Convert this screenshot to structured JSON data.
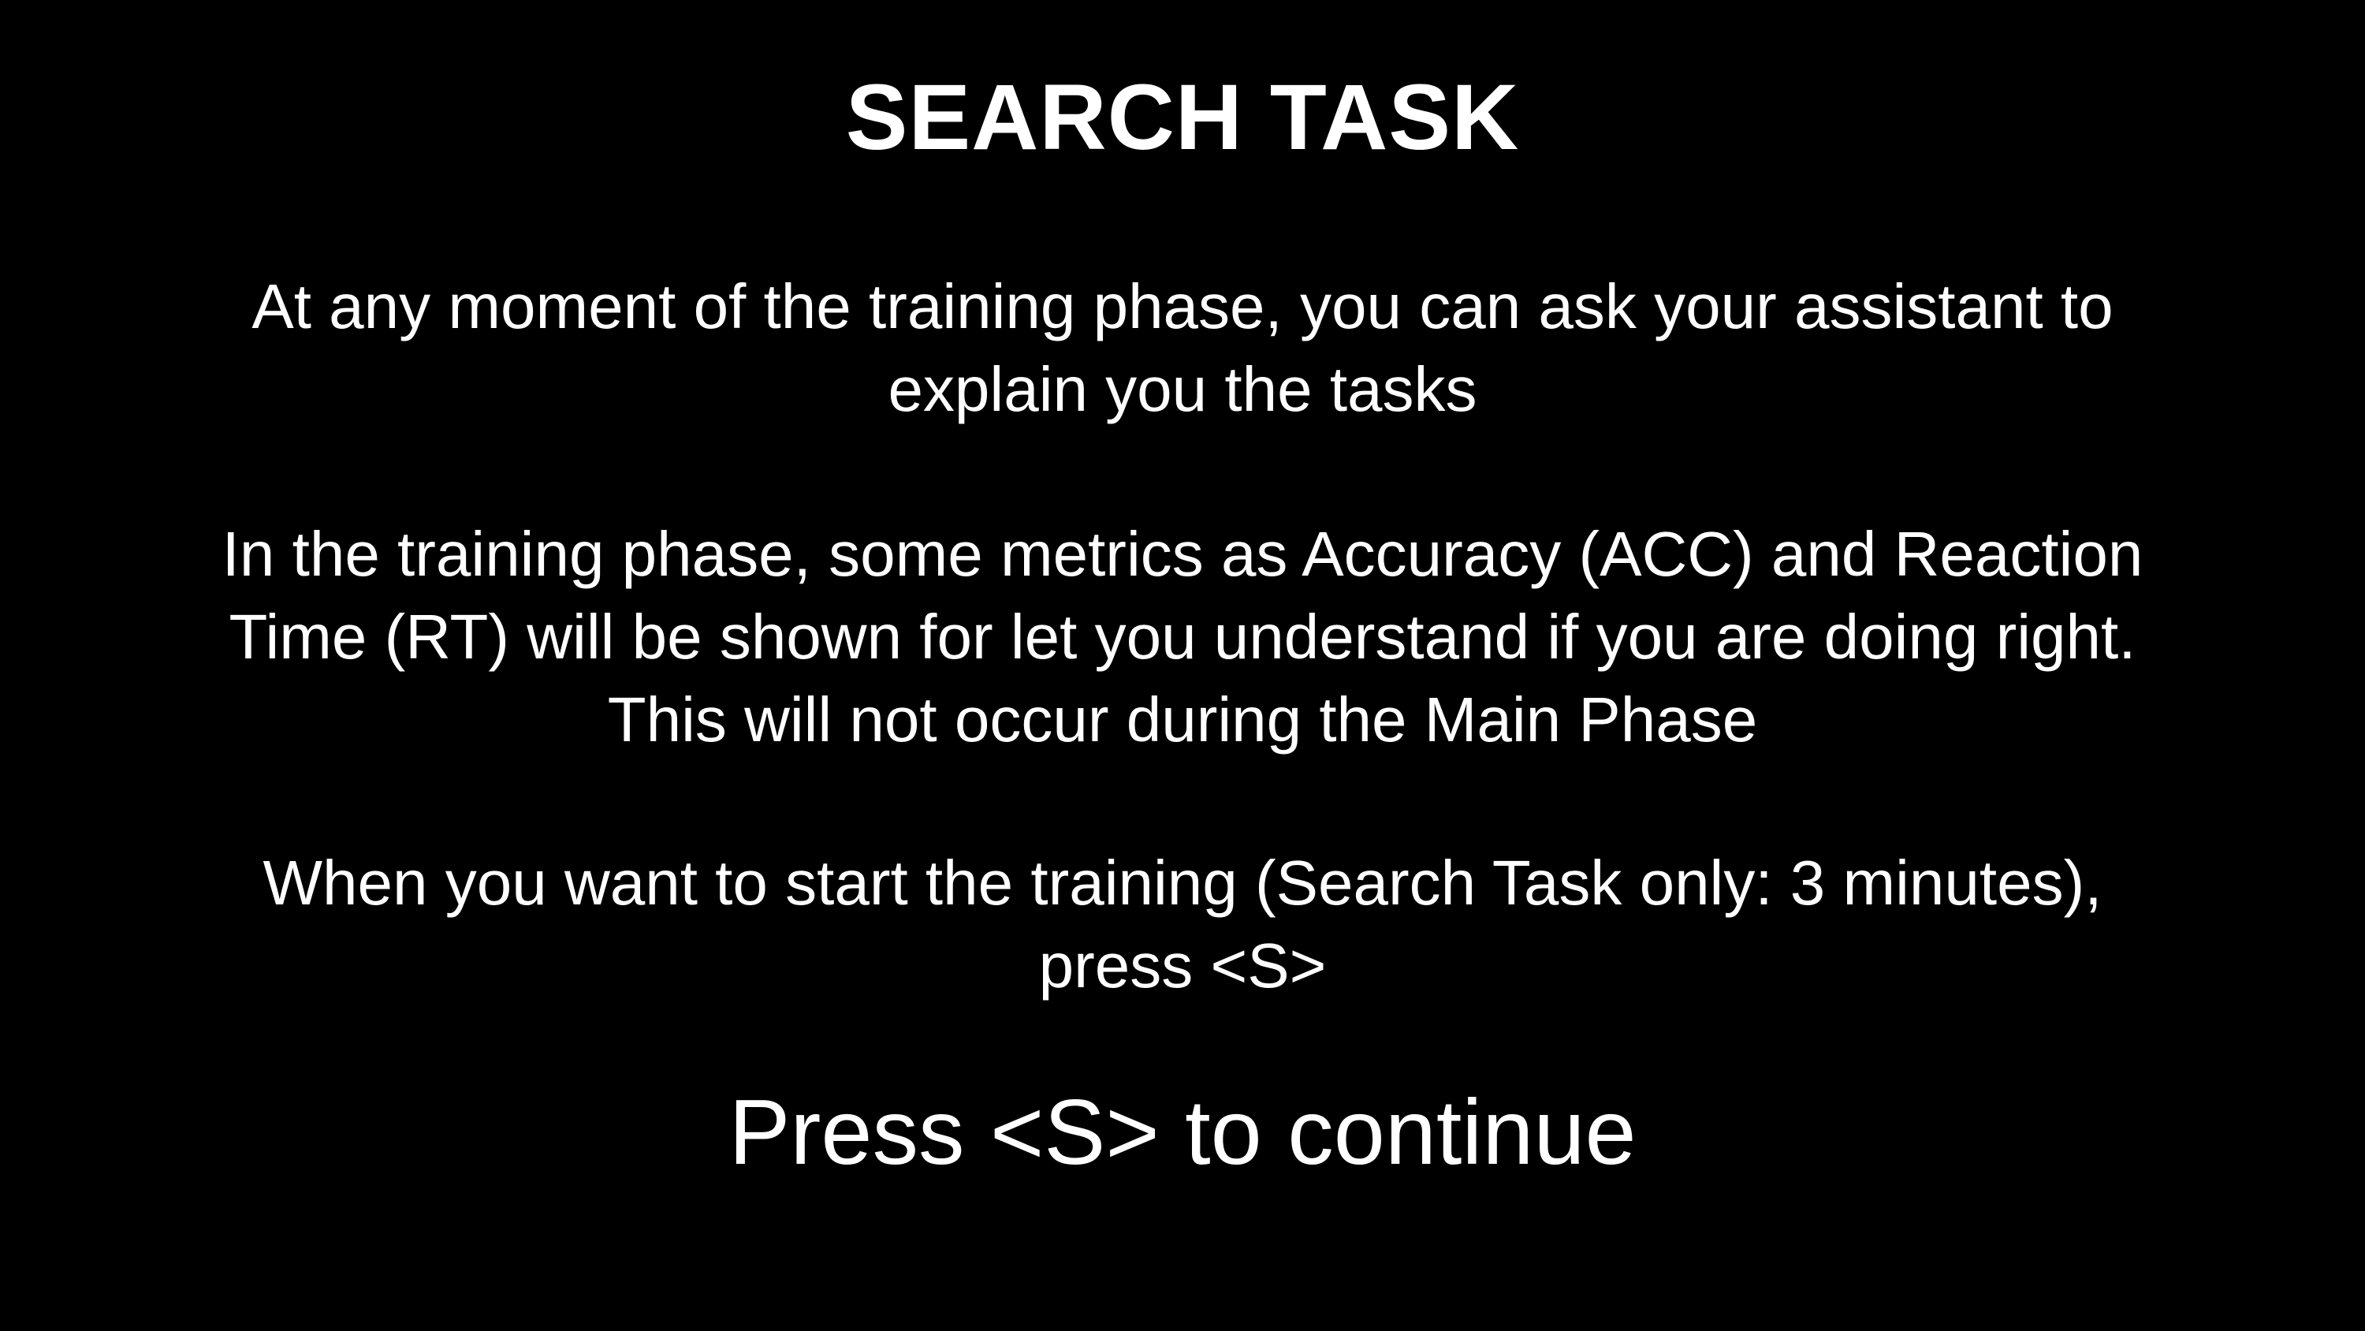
{
  "screen": {
    "title": "SEARCH TASK",
    "paragraphs": [
      {
        "lines": [
          "At any moment of the training phase, you can ask your assistant to",
          "explain you the tasks"
        ]
      },
      {
        "lines": [
          "In the training phase, some metrics as Accuracy (ACC) and Reaction",
          "Time (RT) will be shown for let you understand if you are doing right.",
          "This will not occur during the Main Phase"
        ]
      },
      {
        "lines": [
          "When you want to start the training (Search Task only: 3 minutes),",
          "press <S>"
        ]
      }
    ],
    "continue_prompt": "Press <S> to continue"
  },
  "colors": {
    "background": "#000000",
    "text": "#ffffff"
  }
}
